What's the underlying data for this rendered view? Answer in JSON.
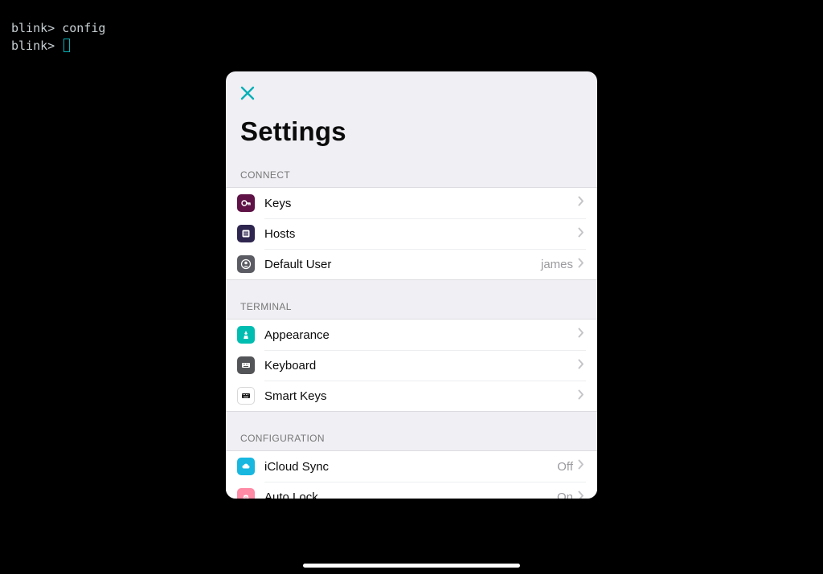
{
  "terminal": {
    "prompt": "blink>",
    "line1_cmd": "config",
    "line2_cmd": ""
  },
  "modal": {
    "title": "Settings",
    "sections": {
      "connect": {
        "header": "CONNECT",
        "keys": "Keys",
        "hosts": "Hosts",
        "default_user_label": "Default User",
        "default_user_value": "james"
      },
      "terminal": {
        "header": "TERMINAL",
        "appearance": "Appearance",
        "keyboard": "Keyboard",
        "smart_keys": "Smart Keys"
      },
      "configuration": {
        "header": "CONFIGURATION",
        "icloud_sync_label": "iCloud Sync",
        "icloud_sync_value": "Off",
        "auto_lock_label": "Auto Lock",
        "auto_lock_value": "On"
      }
    }
  },
  "colors": {
    "accent": "#06b0b7"
  }
}
